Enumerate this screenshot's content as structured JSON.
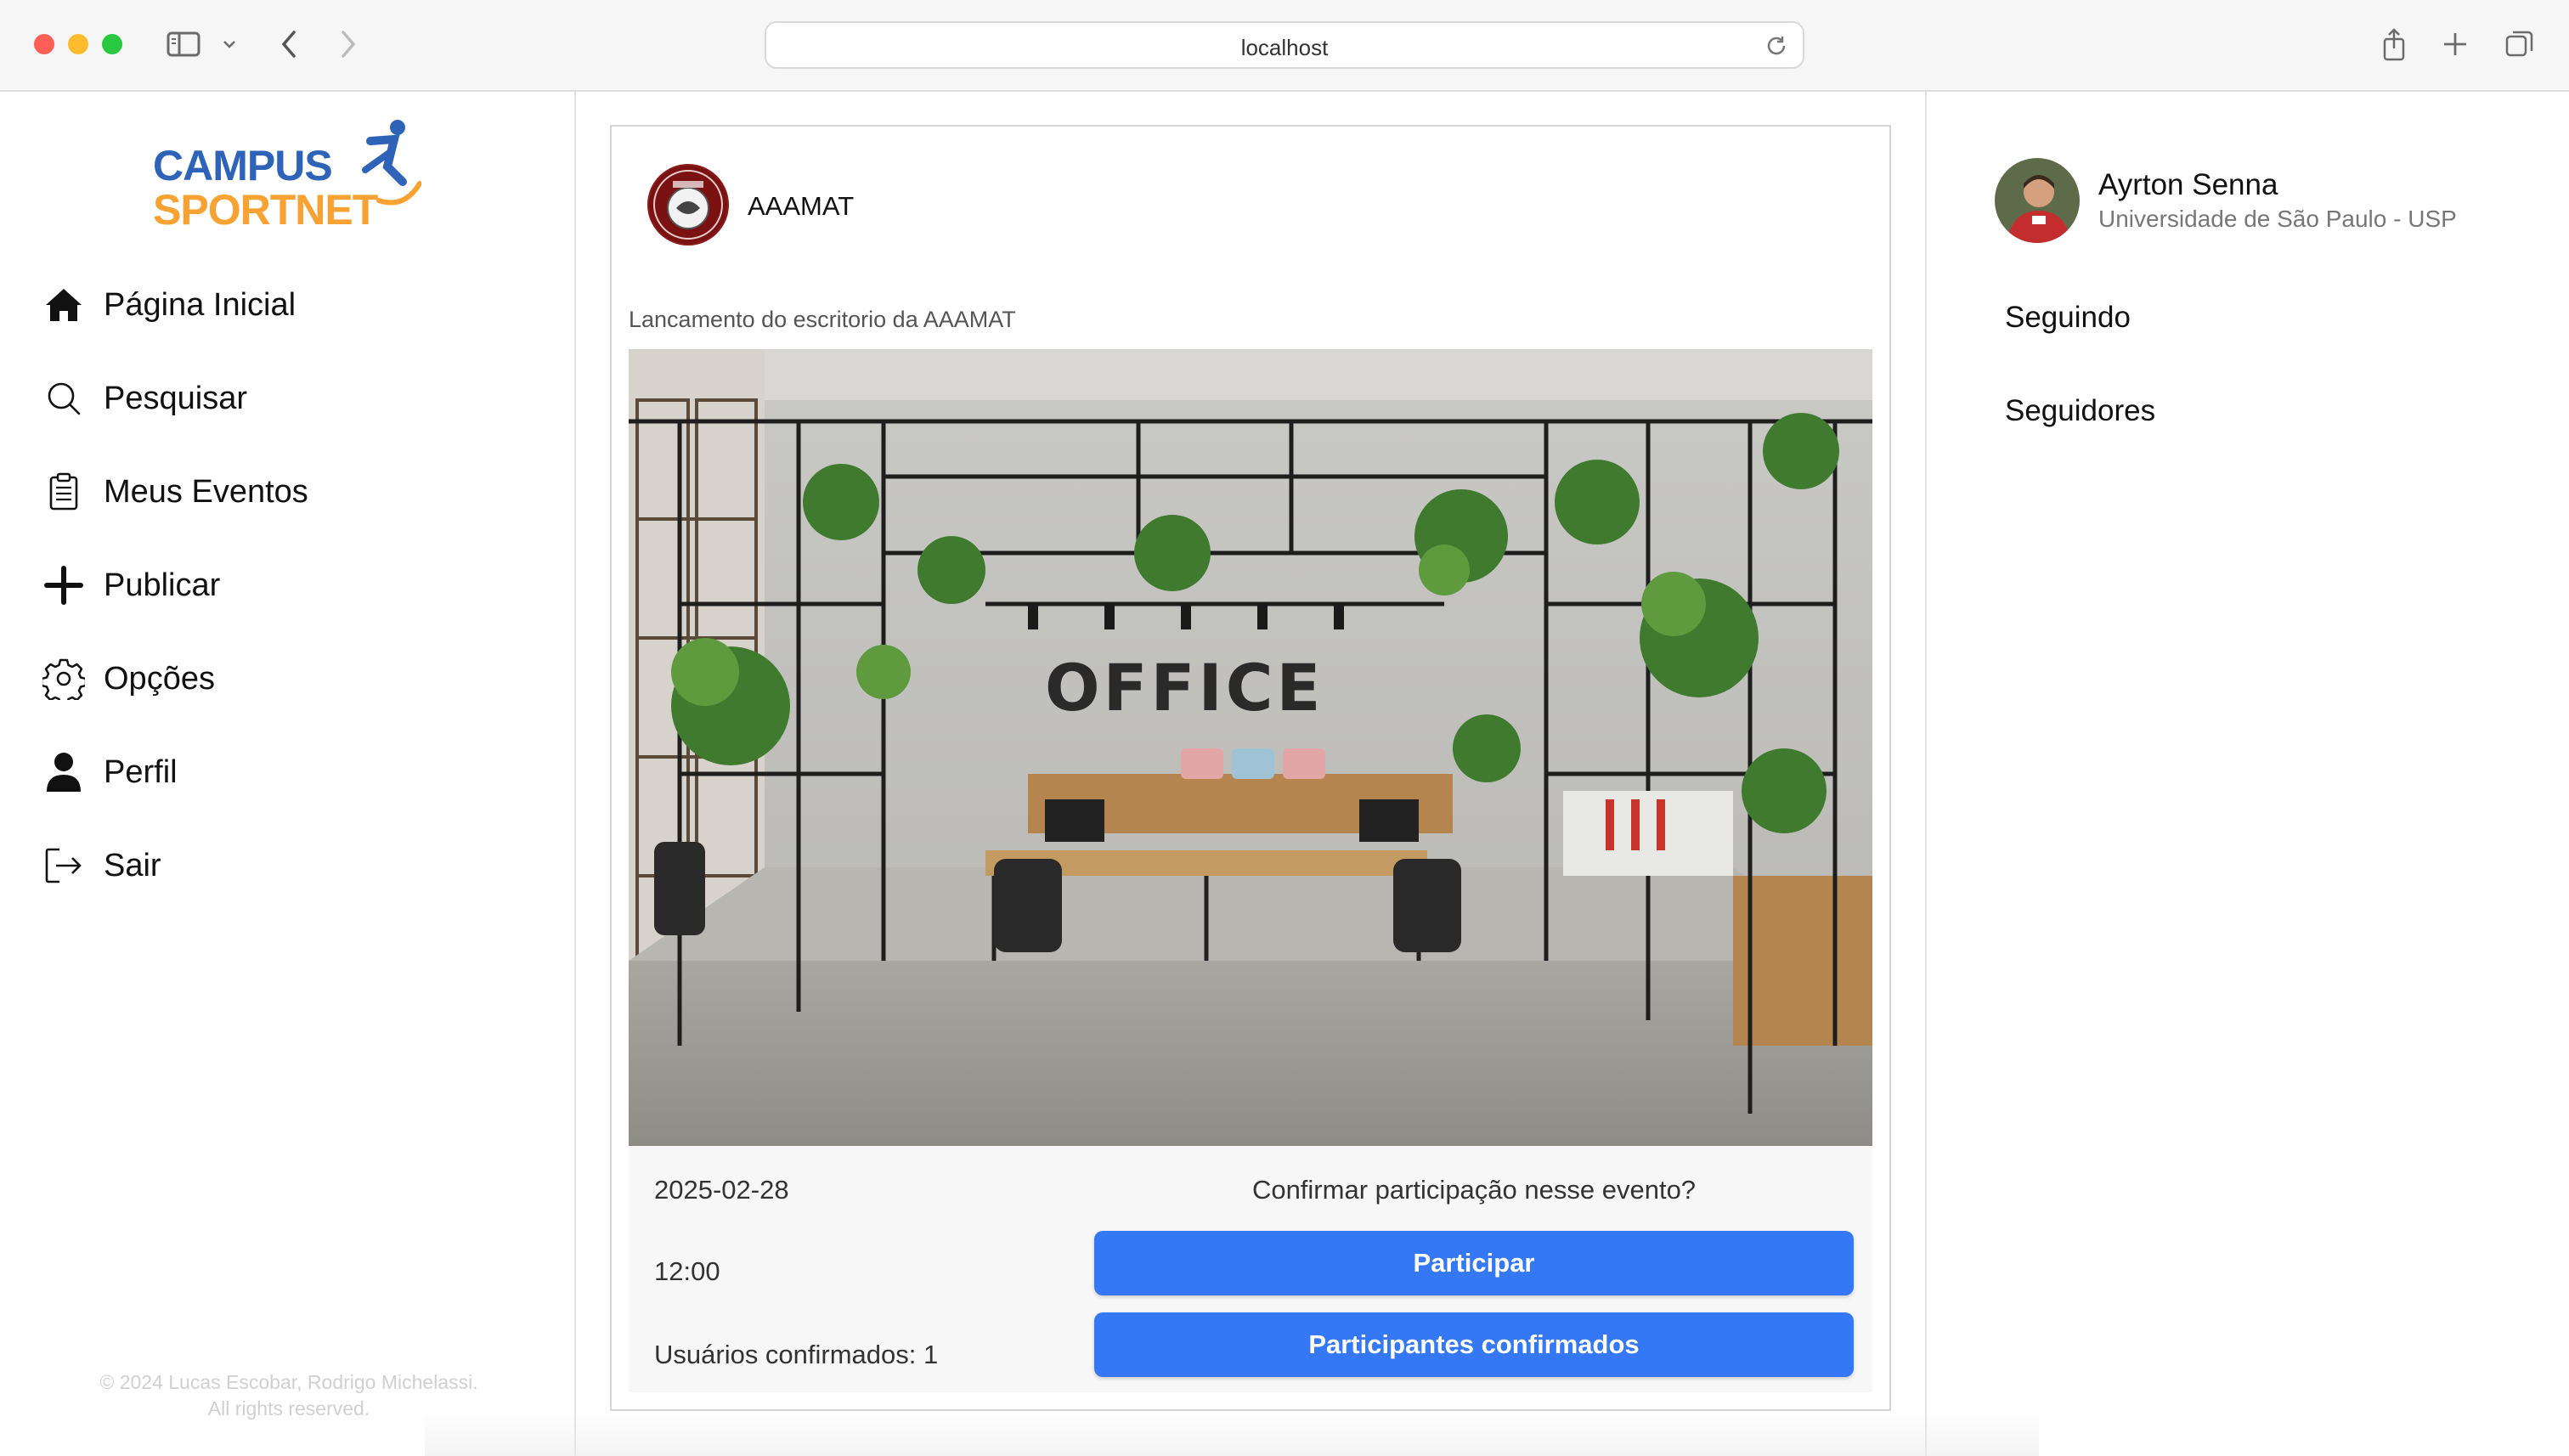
{
  "browser": {
    "url": "localhost"
  },
  "brand": {
    "line1": "CAMPUS",
    "line2": "SPORTNET",
    "colors": {
      "blue": "#2f63b8",
      "orange": "#f7a233"
    }
  },
  "sidebar": {
    "items": [
      {
        "label": "Página Inicial",
        "icon": "home-icon"
      },
      {
        "label": "Pesquisar",
        "icon": "search-icon"
      },
      {
        "label": "Meus Eventos",
        "icon": "clipboard-icon"
      },
      {
        "label": "Publicar",
        "icon": "plus-icon"
      },
      {
        "label": "Opções",
        "icon": "gear-icon"
      },
      {
        "label": "Perfil",
        "icon": "user-icon"
      },
      {
        "label": "Sair",
        "icon": "logout-icon"
      }
    ],
    "footer_line1": "© 2024 Lucas Escobar, Rodrigo Michelassi.",
    "footer_line2": "All rights reserved."
  },
  "post": {
    "author": "AAAMAT",
    "caption": "Lancamento do escritorio da AAAMAT",
    "image_text": "OFFICE",
    "date": "2025-02-28",
    "time": "12:00",
    "confirmed_users": "Usuários confirmados: 1",
    "confirm_question": "Confirmar participação nesse evento?",
    "participate_label": "Participar",
    "participants_label": "Participantes confirmados",
    "accent": "#3478f6"
  },
  "profile": {
    "name": "Ayrton Senna",
    "university": "Universidade de São Paulo - USP",
    "following_label": "Seguindo",
    "followers_label": "Seguidores"
  }
}
